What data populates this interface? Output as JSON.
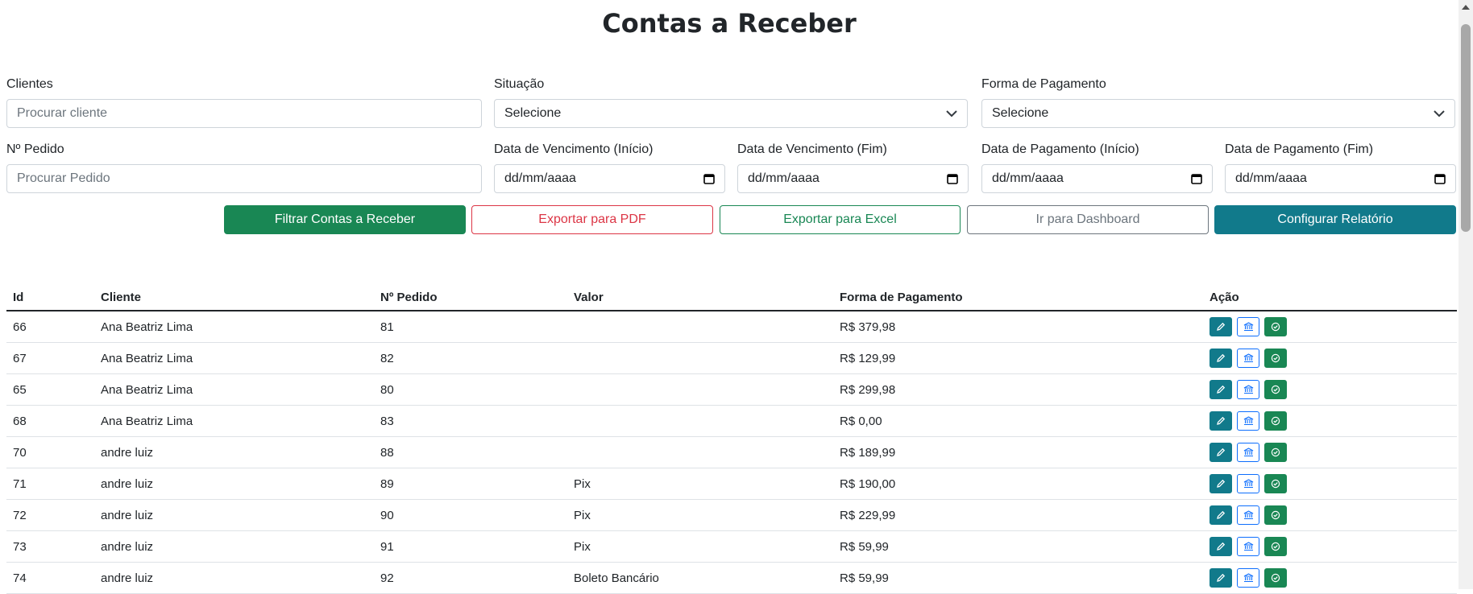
{
  "page": {
    "title": "Contas a Receber"
  },
  "filters": {
    "clientes": {
      "label": "Clientes",
      "placeholder": "Procurar cliente"
    },
    "situacao": {
      "label": "Situação",
      "value": "Selecione"
    },
    "forma_pagamento": {
      "label": "Forma de Pagamento",
      "value": "Selecione"
    },
    "numero_pedido": {
      "label": "Nº Pedido",
      "placeholder": "Procurar Pedido"
    },
    "venc_inicio": {
      "label": "Data de Vencimento (Início)",
      "value": "dd/mm/aaaa"
    },
    "venc_fim": {
      "label": "Data de Vencimento (Fim)",
      "value": "dd/mm/aaaa"
    },
    "pag_inicio": {
      "label": "Data de Pagamento (Início)",
      "value": "dd/mm/aaaa"
    },
    "pag_fim": {
      "label": "Data de Pagamento (Fim)",
      "value": "dd/mm/aaaa"
    }
  },
  "actions": {
    "filtrar": "Filtrar Contas a Receber",
    "pdf": "Exportar para PDF",
    "excel": "Exportar para Excel",
    "dashboard": "Ir para Dashboard",
    "configurar": "Configurar Relatório"
  },
  "table": {
    "headers": [
      "Id",
      "Cliente",
      "Nº Pedido",
      "Valor",
      "Forma de Pagamento",
      "Ação"
    ],
    "rows": [
      [
        "66",
        "Ana Beatriz Lima",
        "81",
        "",
        "R$ 379,98"
      ],
      [
        "67",
        "Ana Beatriz Lima",
        "82",
        "",
        "R$ 129,99"
      ],
      [
        "65",
        "Ana Beatriz Lima",
        "80",
        "",
        "R$ 299,98"
      ],
      [
        "68",
        "Ana Beatriz Lima",
        "83",
        "",
        "R$ 0,00"
      ],
      [
        "70",
        "andre luiz",
        "88",
        "",
        "R$ 189,99"
      ],
      [
        "71",
        "andre luiz",
        "89",
        "Pix",
        "R$ 190,00"
      ],
      [
        "72",
        "andre luiz",
        "90",
        "Pix",
        "R$ 229,99"
      ],
      [
        "73",
        "andre luiz",
        "91",
        "Pix",
        "R$ 59,99"
      ],
      [
        "74",
        "andre luiz",
        "92",
        "Boleto Bancário",
        "R$ 59,99"
      ]
    ],
    "row_actions": [
      "pencil-icon",
      "bank-icon",
      "check-circle-icon"
    ]
  },
  "colors": {
    "success": "#198754",
    "danger": "#dc3545",
    "secondary": "#6c757d",
    "info": "#117a8b",
    "primary": "#0d6efd"
  }
}
